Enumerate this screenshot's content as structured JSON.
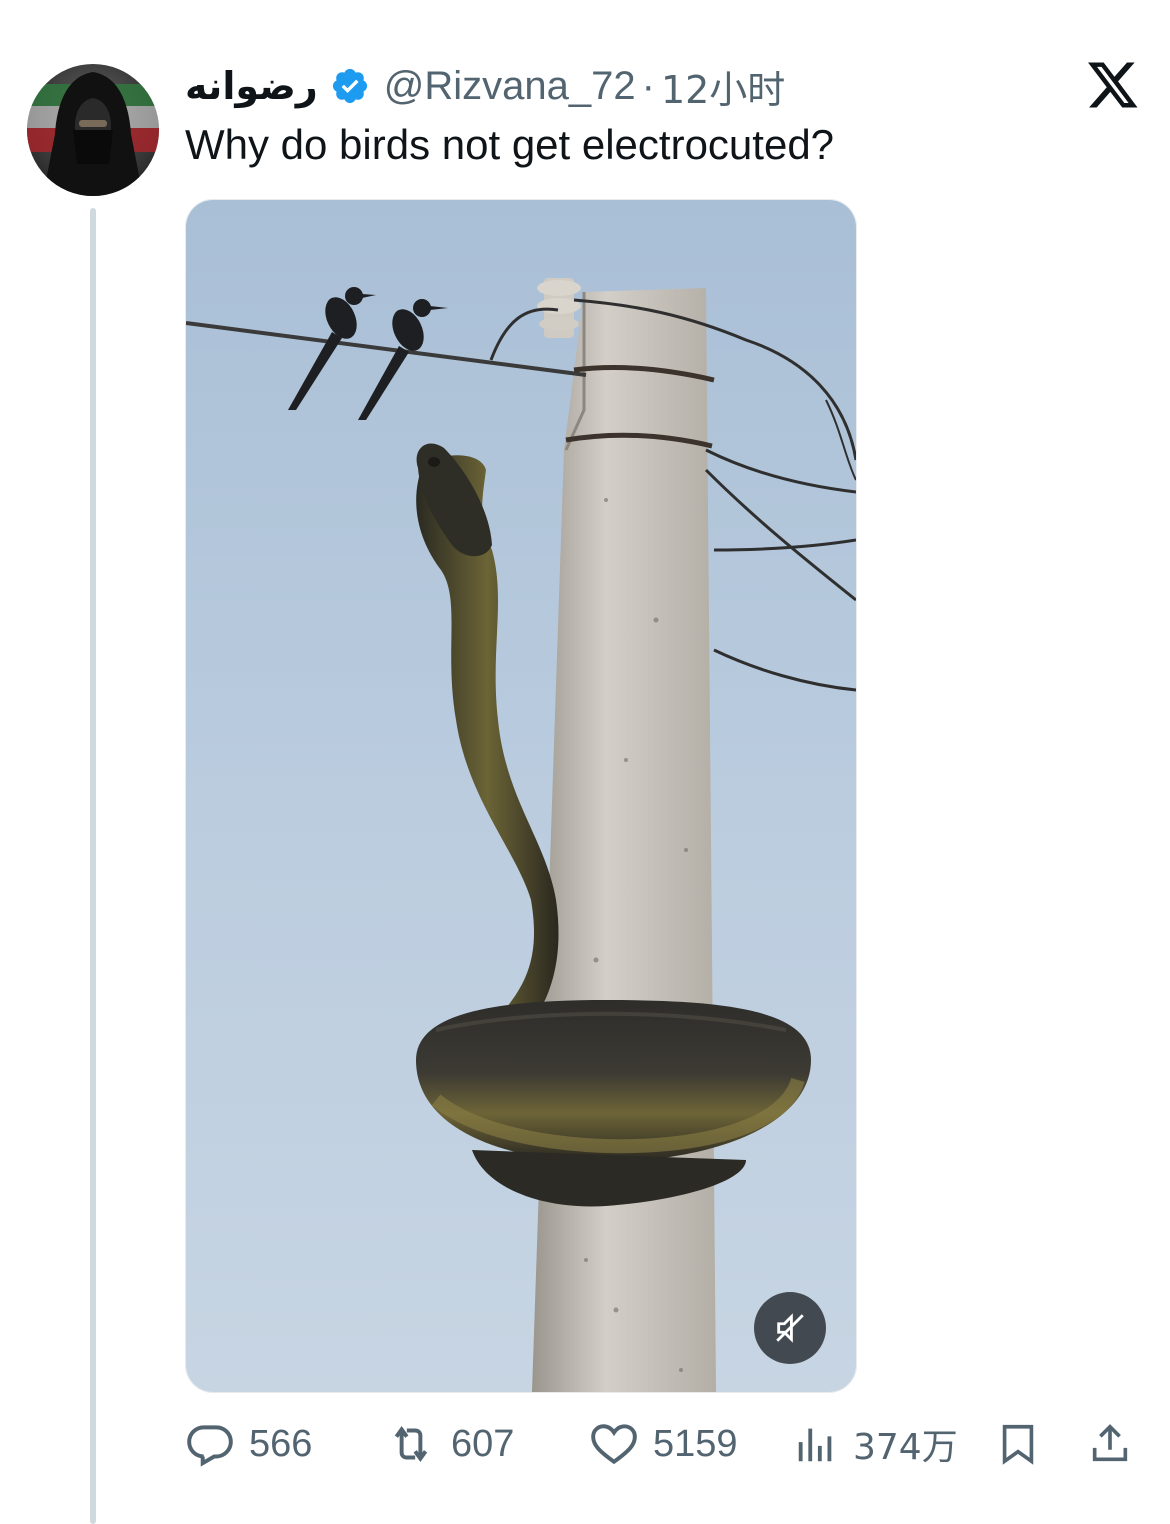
{
  "tweet": {
    "author": {
      "display_name": "رضوانه",
      "handle": "@Rizvana_72",
      "verified": true,
      "avatar_icon": "hooded-figure-avatar"
    },
    "separator": "·",
    "time": "12小时",
    "text": "Why do birds not get electrocuted?",
    "media": {
      "type": "video",
      "mute_icon": "muted-speaker-icon"
    },
    "actions": {
      "replies": "566",
      "retweets": "607",
      "likes": "5159",
      "views": "374万"
    }
  },
  "colors": {
    "text_primary": "#0f1419",
    "text_secondary": "#536471",
    "verified_blue": "#1d9bf0",
    "thread_line": "#cfd9de"
  }
}
